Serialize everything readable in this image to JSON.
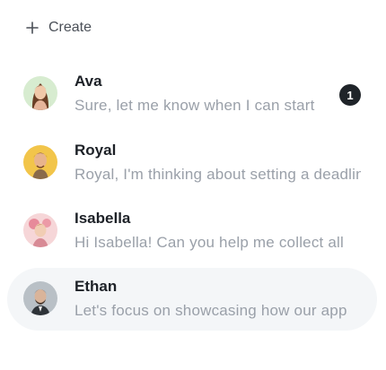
{
  "create": {
    "label": "Create",
    "icon": "plus-icon"
  },
  "chats": [
    {
      "name": "Ava",
      "preview": "Sure, let me know when I can start",
      "unread": "1",
      "avatar_bg": "#d7ecd0"
    },
    {
      "name": "Royal",
      "preview": "Royal, I'm thinking about setting a deadline",
      "avatar_bg": "#f2c54a"
    },
    {
      "name": "Isabella",
      "preview": "Hi Isabella! Can you help me collect all",
      "avatar_bg": "#f6d6d8"
    },
    {
      "name": "Ethan",
      "preview": "Let's focus on showcasing how our app",
      "avatar_bg": "#b9c0c6",
      "active": true
    }
  ],
  "colors": {
    "active_row": "#f4f6f8",
    "badge": "#1f2429",
    "name_text": "#1d2127",
    "preview_text": "#9aa0a9"
  }
}
